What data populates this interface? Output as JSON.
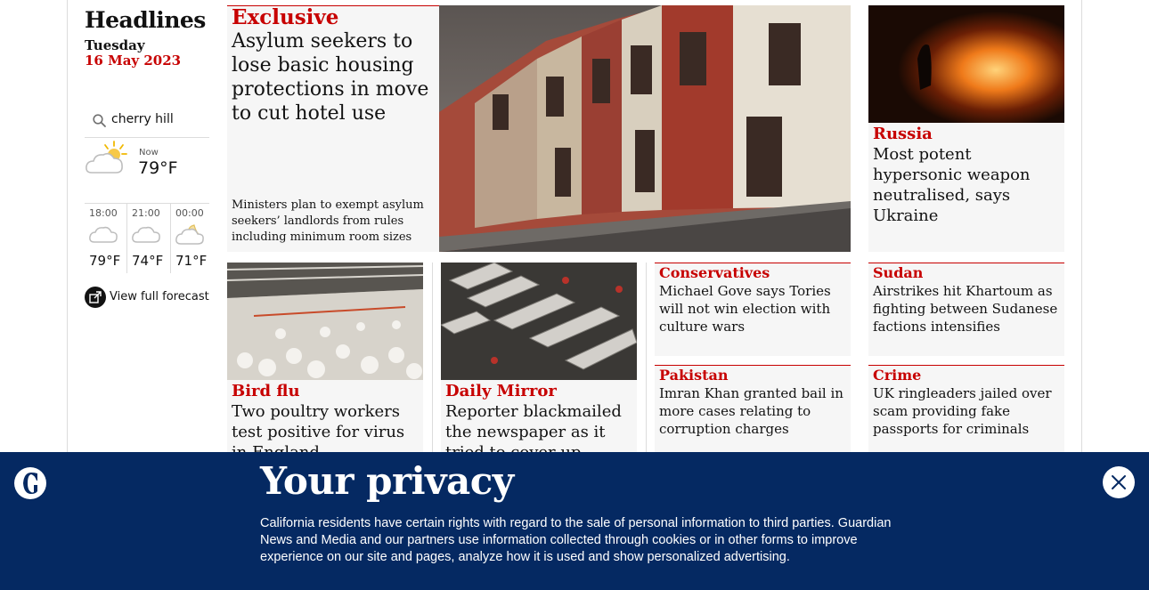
{
  "rail": {
    "title": "Headlines",
    "day": "Tuesday",
    "date": "16 May 2023",
    "search_value": "cherry hill",
    "now_label": "Now",
    "now_temp": "79°F",
    "now_icon": "partly-cloudy-sun-icon",
    "hourly": [
      {
        "time": "18:00",
        "temp": "79°F",
        "icon": "cloud-icon"
      },
      {
        "time": "21:00",
        "temp": "74°F",
        "icon": "cloud-icon"
      },
      {
        "time": "00:00",
        "temp": "71°F",
        "icon": "partly-cloudy-night-icon"
      }
    ],
    "forecast_label": "View full forecast"
  },
  "lead": {
    "kicker": "Exclusive",
    "headline": "Asylum seekers to lose basic housing protections in move to cut hotel use",
    "standfirst": "Ministers plan to exempt asylum seekers’ landlords from rules including minimum room sizes"
  },
  "russia": {
    "kicker": "Russia",
    "headline": "Most potent hypersonic weapon neutralised, says Ukraine"
  },
  "birdflu": {
    "kicker": "Bird flu",
    "headline": "Two poultry workers test positive for virus in England"
  },
  "mirror": {
    "kicker": "Daily Mirror",
    "headline": "Reporter blackmailed the newspaper as it tried to cover up phone hacking"
  },
  "conservatives": {
    "kicker": "Conservatives",
    "headline": "Michael Gove says Tories will not win election with culture wars"
  },
  "sudan": {
    "kicker": "Sudan",
    "headline": "Airstrikes hit Khartoum as fighting between Sudanese factions intensifies"
  },
  "pakistan": {
    "kicker": "Pakistan",
    "headline": "Imran Khan granted bail in more cases relating to corruption charges"
  },
  "crime": {
    "kicker": "Crime",
    "headline": "UK ringleaders jailed over scam providing fake passports for criminals"
  },
  "privacy": {
    "title": "Your privacy",
    "body": "California residents have certain rights with regard to the sale of personal information to third parties. Guardian News and Media and our partners use information collected through cookies or in other forms to improve experience on our site and pages, analyze how it is used and show personalized advertising."
  },
  "colors": {
    "accent": "#c70000",
    "banner": "#052962",
    "card": "#f6f6f6"
  }
}
